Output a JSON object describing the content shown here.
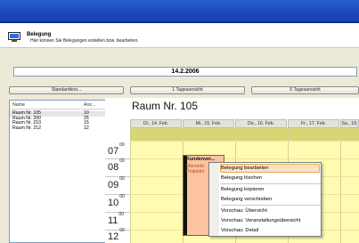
{
  "header": {
    "title": "Belegung",
    "subtitle": "Hier können Sie Belegungen erstellen bzw. bearbeiten."
  },
  "date_display": "14.2.2006",
  "buttons": {
    "standard_text": "Standardtext...",
    "one_day_view": "1 Tagesansicht",
    "five_day_view": "5 Tagesansicht"
  },
  "room_list": {
    "columns": [
      "Name",
      "Anz..."
    ],
    "rows": [
      {
        "name": "Raum Nr. 105",
        "count": "10"
      },
      {
        "name": "Raum Nr. 200",
        "count": "25"
      },
      {
        "name": "Raum Nr. 210",
        "count": "15"
      },
      {
        "name": "Raum Nr. 212",
        "count": "12"
      }
    ]
  },
  "calendar": {
    "room_title": "Raum Nr. 105",
    "days": [
      "Di., 14. Feb.",
      "Mi., 15. Feb.",
      "Do., 16. Feb.",
      "Fr., 17. Feb.",
      "Sa., 18."
    ],
    "hours": [
      "07",
      "08",
      "09",
      "10",
      "11",
      "12"
    ],
    "minutes": "00",
    "event": {
      "title": "Kundenver...",
      "lines": [
        "Macnetic",
        "Projektm"
      ]
    }
  },
  "context_menu": {
    "items": [
      "Belegung bearbeiten",
      "Belegung löschen",
      "Belegung kopieren",
      "Belegung verschieben",
      "Vorschau: Übersicht",
      "Vorschau: Veranstaltungsübersicht",
      "Vorschau: Detail"
    ]
  }
}
